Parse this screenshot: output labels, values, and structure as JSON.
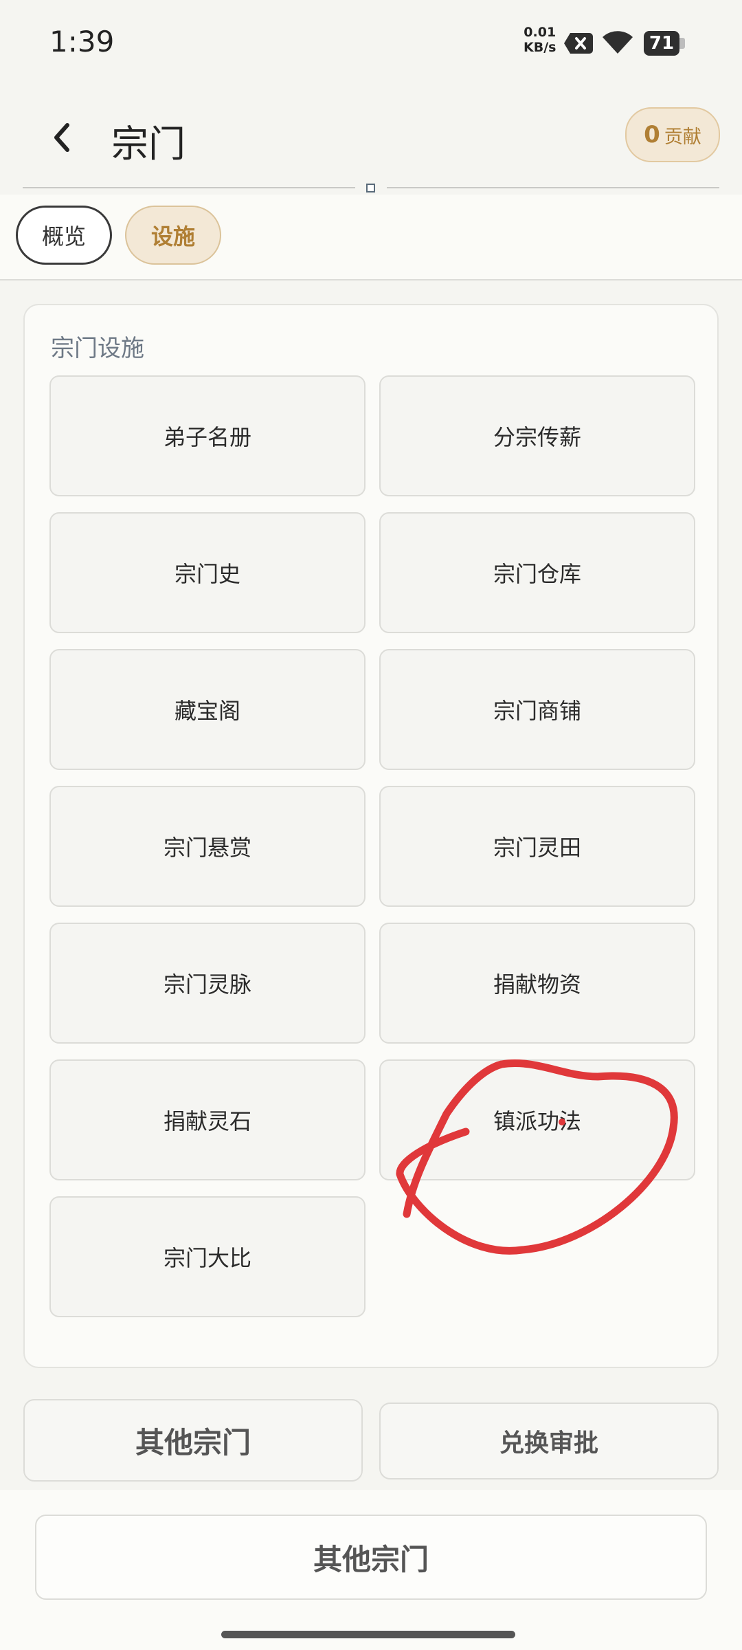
{
  "status_bar": {
    "time": "1:39",
    "net_speed_value": "0.01",
    "net_speed_unit": "KB/s",
    "battery_level": "71"
  },
  "header": {
    "title": "宗门",
    "contribution_value": "0",
    "contribution_label": "贡献"
  },
  "tabs": [
    {
      "label": "概览",
      "active": false
    },
    {
      "label": "设施",
      "active": true
    }
  ],
  "facilities": {
    "section_title": "宗门设施",
    "items": [
      "弟子名册",
      "分宗传薪",
      "宗门史",
      "宗门仓库",
      "藏宝阁",
      "宗门商铺",
      "宗门悬赏",
      "宗门灵田",
      "宗门灵脉",
      "捐献物资",
      "捐献灵石",
      "镇派功法",
      "宗门大比"
    ]
  },
  "actions": {
    "other_sects": "其他宗门",
    "exchange_approval": "兑换审批",
    "other_sects_bottom": "其他宗门"
  },
  "colors": {
    "accent_gold": "#b07f34",
    "annotation_red": "#e0383a"
  }
}
